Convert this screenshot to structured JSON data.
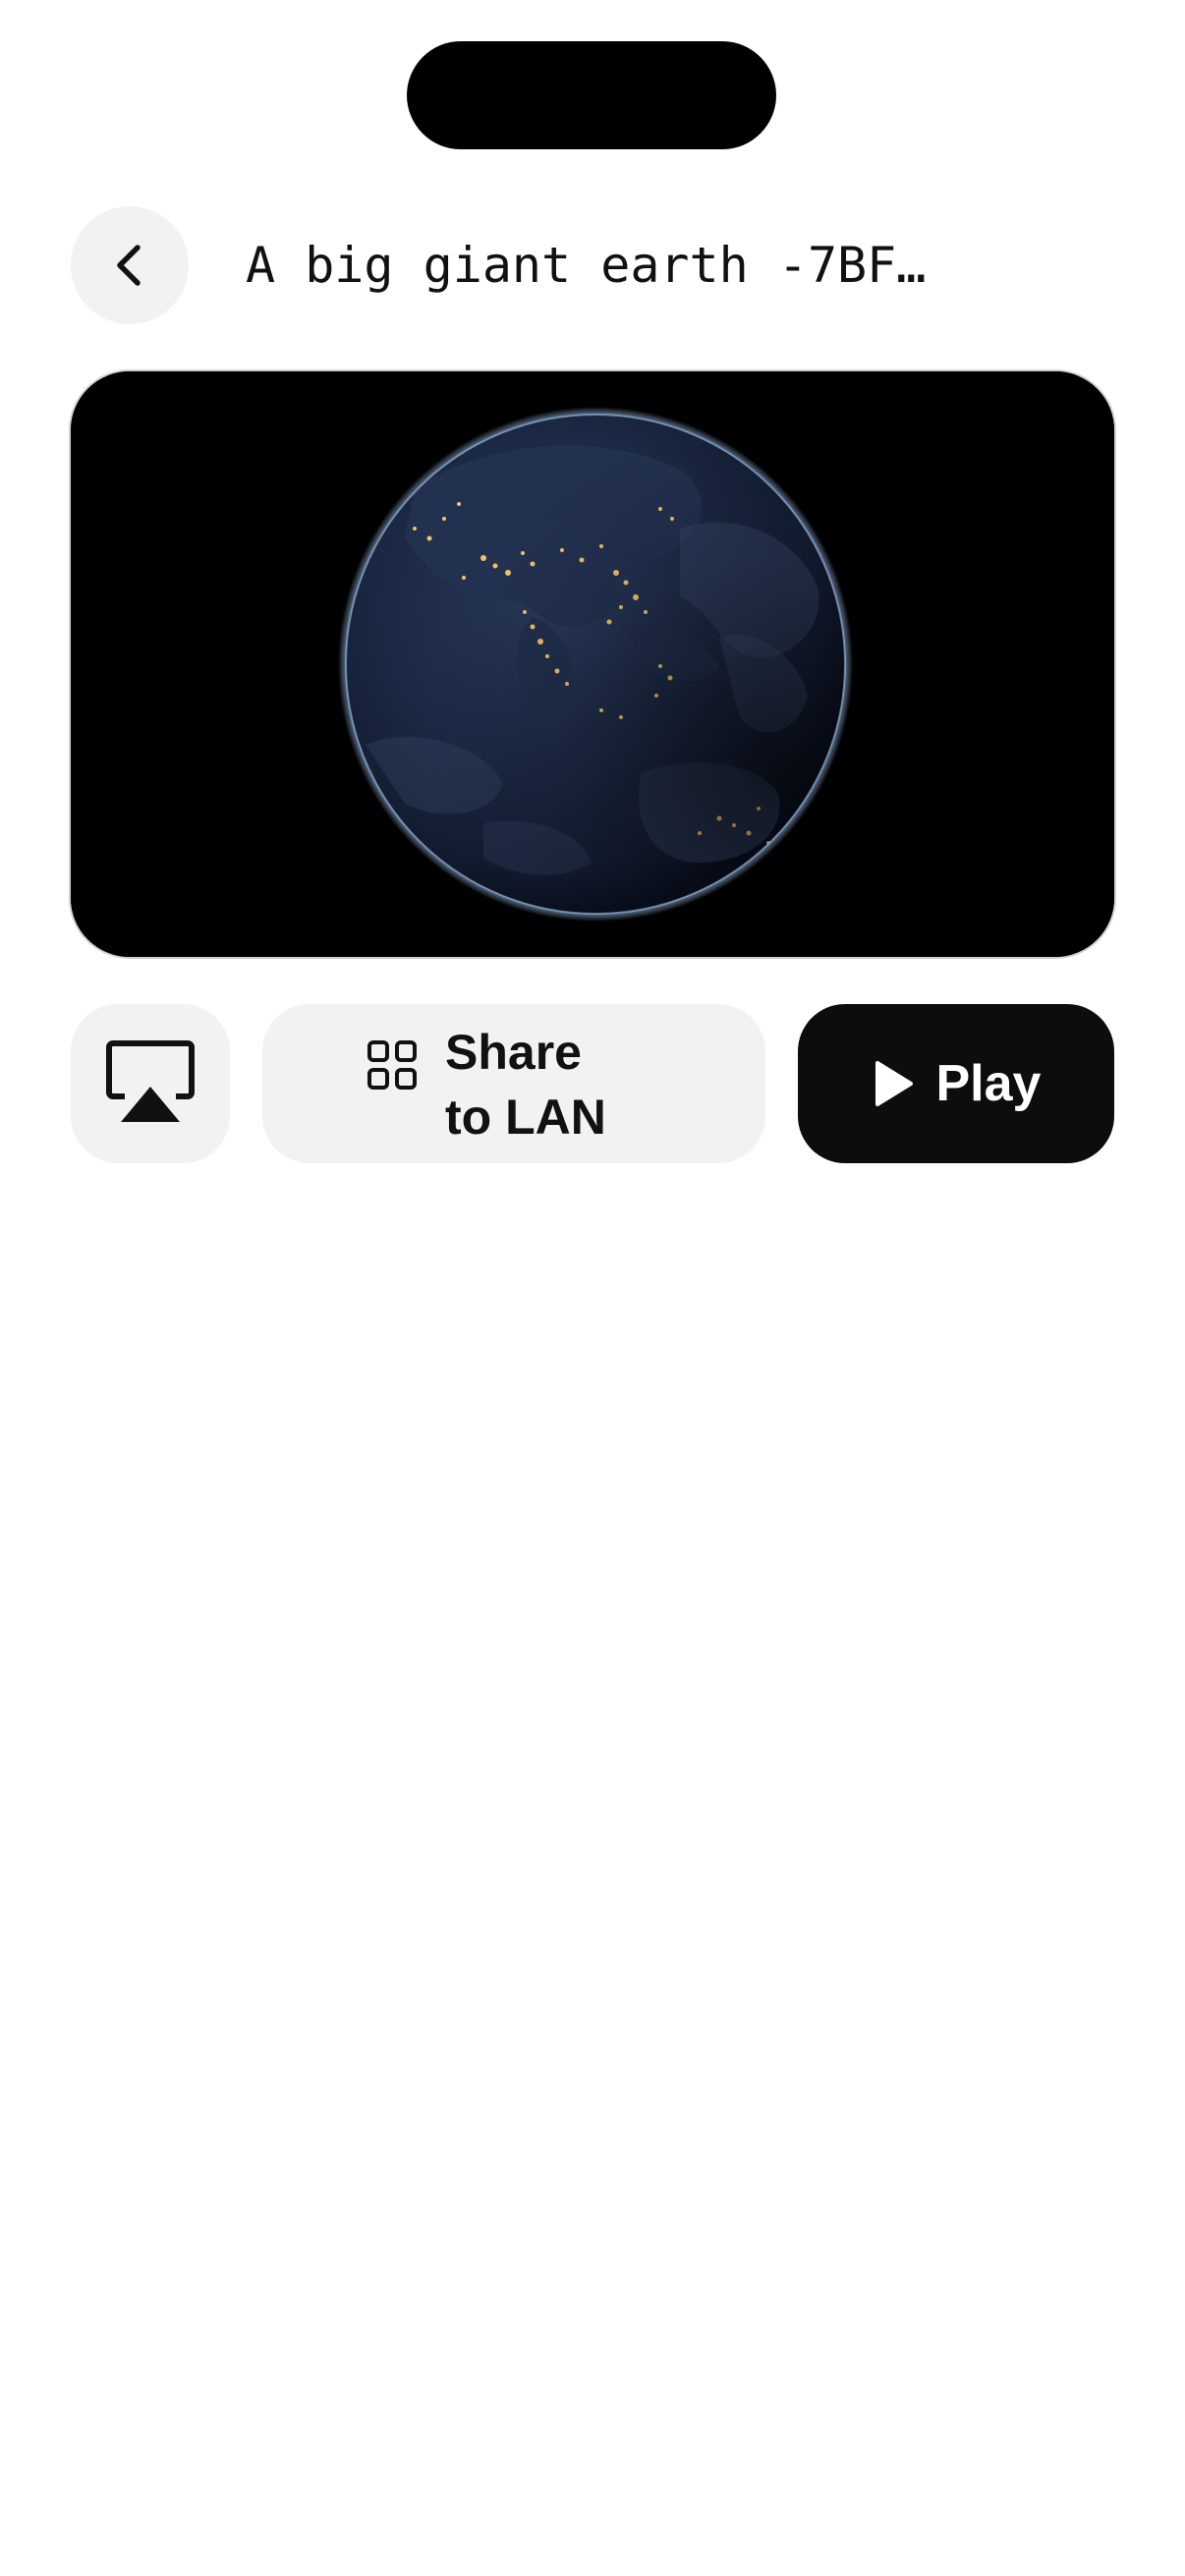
{
  "header": {
    "back_icon": "chevron-left-icon",
    "title": "A big giant earth -7BF…"
  },
  "media": {
    "preview": "earth-at-night-image"
  },
  "actions": {
    "airplay_icon": "airplay-icon",
    "share_icon": "grid-icon",
    "share_label_line1": "Share",
    "share_label_line2": "to LAN",
    "play_icon": "play-icon",
    "play_label": "Play"
  },
  "colors": {
    "background": "#ffffff",
    "button_light": "#f2f2f2",
    "button_dark": "#0d0d0d",
    "text": "#111111"
  }
}
